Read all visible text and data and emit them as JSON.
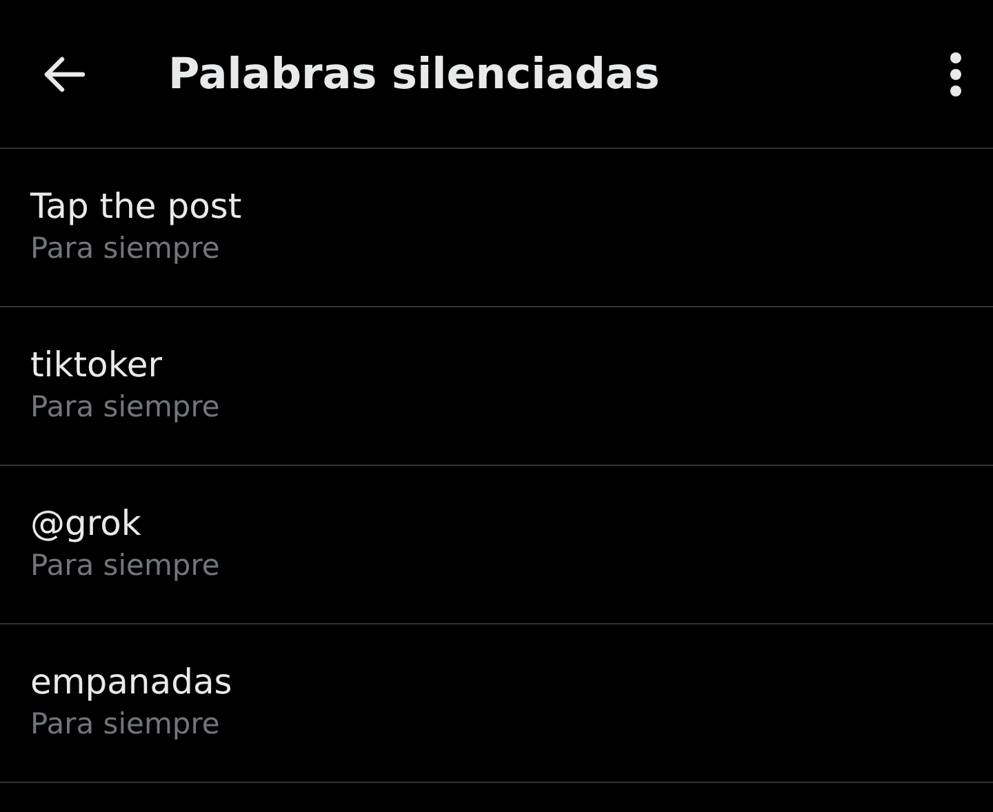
{
  "header": {
    "title": "Palabras silenciadas"
  },
  "muted_words": [
    {
      "word": "Tap the post",
      "duration": "Para siempre"
    },
    {
      "word": "tiktoker",
      "duration": "Para siempre"
    },
    {
      "word": "@grok",
      "duration": "Para siempre"
    },
    {
      "word": "empanadas",
      "duration": "Para siempre"
    }
  ]
}
